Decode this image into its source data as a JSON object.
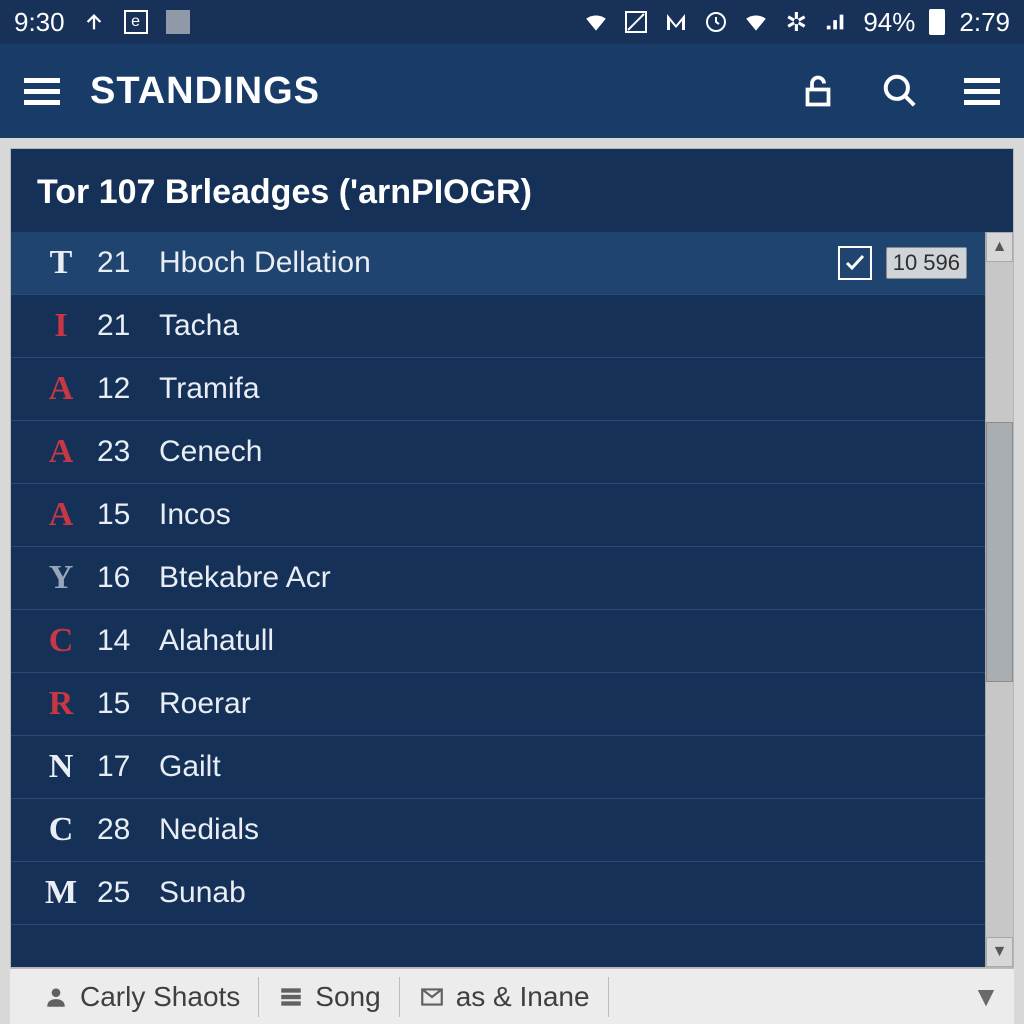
{
  "status": {
    "time_left": "9:30",
    "battery_pct": "94%",
    "time_right": "2:79"
  },
  "header": {
    "title": "STANDINGS"
  },
  "card": {
    "title": "Tor 107 Brleadges ('arnPIOGR)"
  },
  "rows": [
    {
      "letter": "T",
      "cls": "white",
      "num": "21",
      "name": "Hboch Dellation",
      "checked": true,
      "badge": "10 596"
    },
    {
      "letter": "I",
      "cls": "red",
      "num": "21",
      "name": "Tacha"
    },
    {
      "letter": "A",
      "cls": "red",
      "num": "12",
      "name": "Tramifa"
    },
    {
      "letter": "A",
      "cls": "red",
      "num": "23",
      "name": "Cenech"
    },
    {
      "letter": "A",
      "cls": "red",
      "num": "15",
      "name": "Incos"
    },
    {
      "letter": "Y",
      "cls": "gray",
      "num": "16",
      "name": "Btekabre Acr"
    },
    {
      "letter": "C",
      "cls": "red",
      "num": "14",
      "name": "Alahatull"
    },
    {
      "letter": "R",
      "cls": "red",
      "num": "15",
      "name": "Roerar"
    },
    {
      "letter": "N",
      "cls": "white",
      "num": "17",
      "name": "Gailt"
    },
    {
      "letter": "C",
      "cls": "white",
      "num": "28",
      "name": "Nedials"
    },
    {
      "letter": "M",
      "cls": "white",
      "num": "25",
      "name": "Sunab"
    }
  ],
  "bottom": {
    "item1": "Carly Shaots",
    "item2": "Song",
    "item3": "as & Inane"
  }
}
